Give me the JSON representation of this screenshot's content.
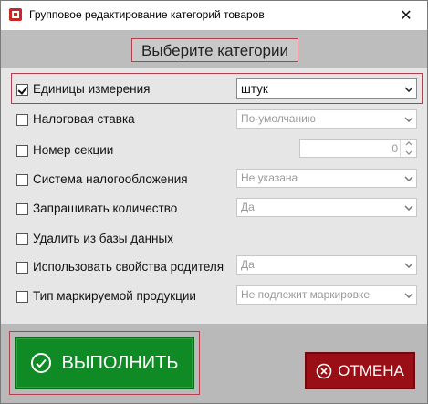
{
  "window": {
    "title": "Групповое редактирование категорий товаров",
    "close_label": "✕"
  },
  "header": {
    "title": "Выберите категории"
  },
  "rows": [
    {
      "label": "Единицы измерения",
      "checked": true,
      "control": "select",
      "value": "штук",
      "active": true
    },
    {
      "label": "Налоговая ставка",
      "checked": false,
      "control": "select",
      "value": "По-умолчанию"
    },
    {
      "label": "Номер секции",
      "checked": false,
      "control": "spinner",
      "value": "0"
    },
    {
      "label": "Система налогообложения",
      "checked": false,
      "control": "select",
      "value": "Не указана"
    },
    {
      "label": "Запрашивать количество",
      "checked": false,
      "control": "select",
      "value": "Да"
    },
    {
      "label": "Удалить из базы данных",
      "checked": false,
      "control": "none"
    },
    {
      "label": "Использовать свойства родителя",
      "checked": false,
      "control": "select",
      "value": "Да"
    },
    {
      "label": "Тип маркируемой продукции",
      "checked": false,
      "control": "select",
      "value": "Не подлежит маркировке"
    }
  ],
  "footer": {
    "execute_label": "ВЫПОЛНИТЬ",
    "cancel_label": "ОТМЕНА"
  },
  "colors": {
    "execute": "#0f8a24",
    "cancel": "#9a0f16",
    "highlight_border": "#b04050"
  }
}
